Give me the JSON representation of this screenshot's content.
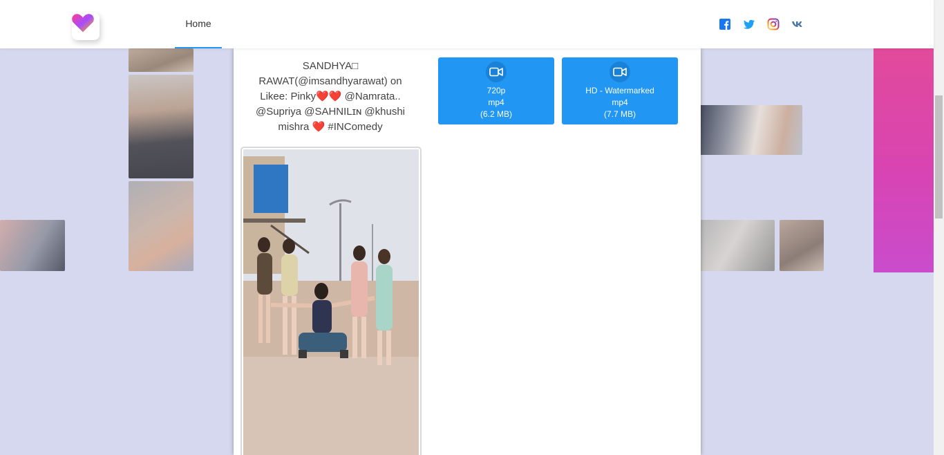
{
  "header": {
    "nav": {
      "home_label": "Home"
    },
    "socials": [
      "facebook",
      "twitter",
      "instagram",
      "vk"
    ]
  },
  "video": {
    "caption": "SANDHYA□ RAWAT(@imsandhyarawat) on Likee: Pinky❤️❤️ @Namrata.. @Supriya @SAHNILɪɴ @khushi mishra ❤️ #INComedy"
  },
  "downloads": [
    {
      "quality": "720p",
      "format": "mp4",
      "size": "(6.2 MB)",
      "icon": "video-camera-icon"
    },
    {
      "quality": "HD - Watermarked",
      "format": "mp4",
      "size": "(7.7 MB)",
      "icon": "video-camera-icon"
    }
  ],
  "colors": {
    "accent": "#2196f3",
    "facebook": "#1877f2",
    "twitter": "#1da1f2",
    "vk": "#4a76a8"
  }
}
